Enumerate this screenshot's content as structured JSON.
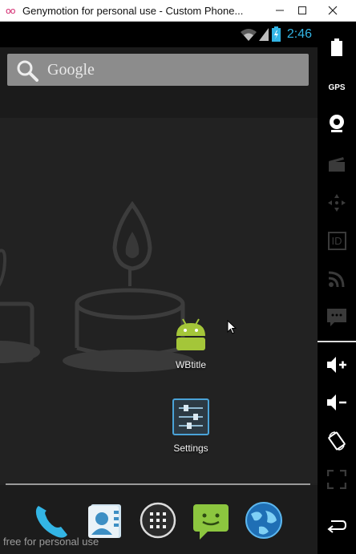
{
  "window": {
    "logo": "oo",
    "title": "Genymotion for personal use - Custom Phone...",
    "minimize": "—",
    "maximize": "☐",
    "close": "✕"
  },
  "status": {
    "time": "2:46"
  },
  "search": {
    "text": "Google"
  },
  "apps": [
    {
      "label": "WBtitle"
    },
    {
      "label": "Settings"
    }
  ],
  "dock": {
    "items": [
      "phone",
      "contacts",
      "all-apps",
      "messaging",
      "browser"
    ]
  },
  "watermark": "free for personal use",
  "sidebar": {
    "gps_label": "GPS",
    "id_label": "ID"
  },
  "colors": {
    "accent": "#33b5e5",
    "android_green": "#a4c639",
    "logo": "#d2236b"
  }
}
